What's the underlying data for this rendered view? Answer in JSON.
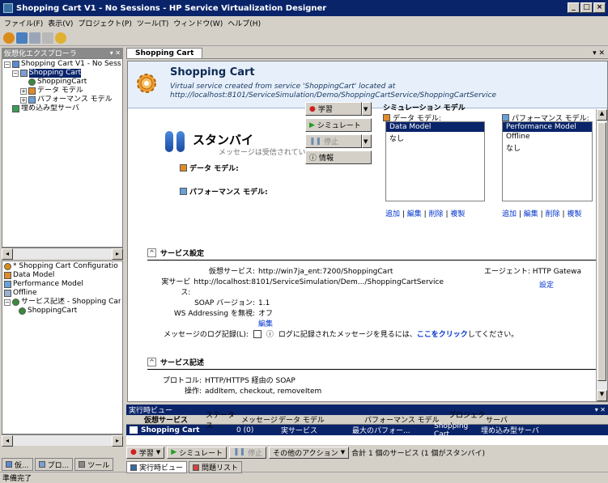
{
  "window": {
    "title": "Shopping Cart V1 - No Sessions - HP Service Virtualization Designer"
  },
  "menu": [
    "ファイル(F)",
    "表示(V)",
    "プロジェクト(P)",
    "ツール(T)",
    "ウィンドウ(W)",
    "ヘルプ(H)"
  ],
  "explorer": {
    "title": "仮想化エクスプローラ",
    "items": [
      "Shopping Cart V1 - No Sess",
      "Shopping Cart",
      "ShoppingCart",
      "データ モデル",
      "パフォーマンス モデル",
      "埋め込み型サーバ"
    ]
  },
  "config_tree": {
    "items": [
      "* Shopping Cart Configuratio",
      "Data Model",
      "Performance Model",
      "Offline",
      "サービス記述 - Shopping Cart",
      "ShoppingCart"
    ]
  },
  "left_tabs": [
    "仮...",
    "プロ...",
    "ツール"
  ],
  "status": "準備完了",
  "doc": {
    "tab": "Shopping Cart",
    "title": "Shopping Cart",
    "description": "Virtual service created from service 'ShoppingCart' located at http://localhost:8101/ServiceSimulation/Demo/ShoppingCartService/ShoppingCartService",
    "state": "スタンバイ",
    "state_sub": "メッセージは受信されてい...",
    "data_model_label": "データ モデル:",
    "perf_model_label": "パフォーマンス モデル:",
    "buttons": {
      "learn": "学習",
      "simulate": "シミュレート",
      "stop": "停止",
      "info": "情報"
    },
    "sim_model_title": "シミュレーション モデル",
    "data_model_list_label": "データ モデル:",
    "data_models": [
      "Data Model",
      "なし"
    ],
    "perf_model_list_label": "パフォーマンス モデル:",
    "perf_models": [
      "Performance Model",
      "Offline",
      "なし"
    ],
    "list_links": [
      "追加",
      "編集",
      "削除",
      "複製"
    ],
    "settings_title": "サービス設定",
    "settings": {
      "virtual_label": "仮想サービス:",
      "virtual": "http://win7ja_ent:7200/ShoppingCart",
      "real_label": "実サービス:",
      "real": "http://localhost:8101/ServiceSimulation/Dem.../ShoppingCartService",
      "soap_label": "SOAP バージョン:",
      "soap": "1.1",
      "wsa_label": "WS Addressing を無視:",
      "wsa": "オフ",
      "edit": "編集",
      "agent_label": "エージェント:",
      "agent": "HTTP Gatewa",
      "agent_settings": "設定"
    },
    "log_label": "メッセージのログ記録(L):",
    "log_hint_prefix": "ログに記録されたメッセージを見るには、",
    "log_hint_link": "ここをクリック",
    "log_hint_suffix": "してください。",
    "descr_title": "サービス記述",
    "protocol_label": "プロトコル:",
    "protocol": "HTTP/HTTPS 経由の SOAP",
    "ops_label": "操作:",
    "ops": "addItem, checkout, removeItem"
  },
  "runtime": {
    "title": "実行時ビュー",
    "columns": [
      "仮想サービス",
      "ステータス",
      "メッセージ",
      "データ モデル",
      "パフォーマンス モデル",
      "プロジェクト",
      "サーバ"
    ],
    "row": {
      "service": "Shopping Cart",
      "messages": "0 (0)",
      "data": "実サービス",
      "perf": "最大のパフォー...",
      "project": "Shopping Cart",
      "server": "埋め込み型サーバ"
    },
    "buttons": {
      "learn": "学習",
      "simulate": "シミュレート",
      "stop": "停止",
      "other": "その他のアクション"
    },
    "summary": "合計 1 個のサービス (1 個がスタンバイ)",
    "tabs": [
      "実行時ビュー",
      "問題リスト"
    ]
  }
}
